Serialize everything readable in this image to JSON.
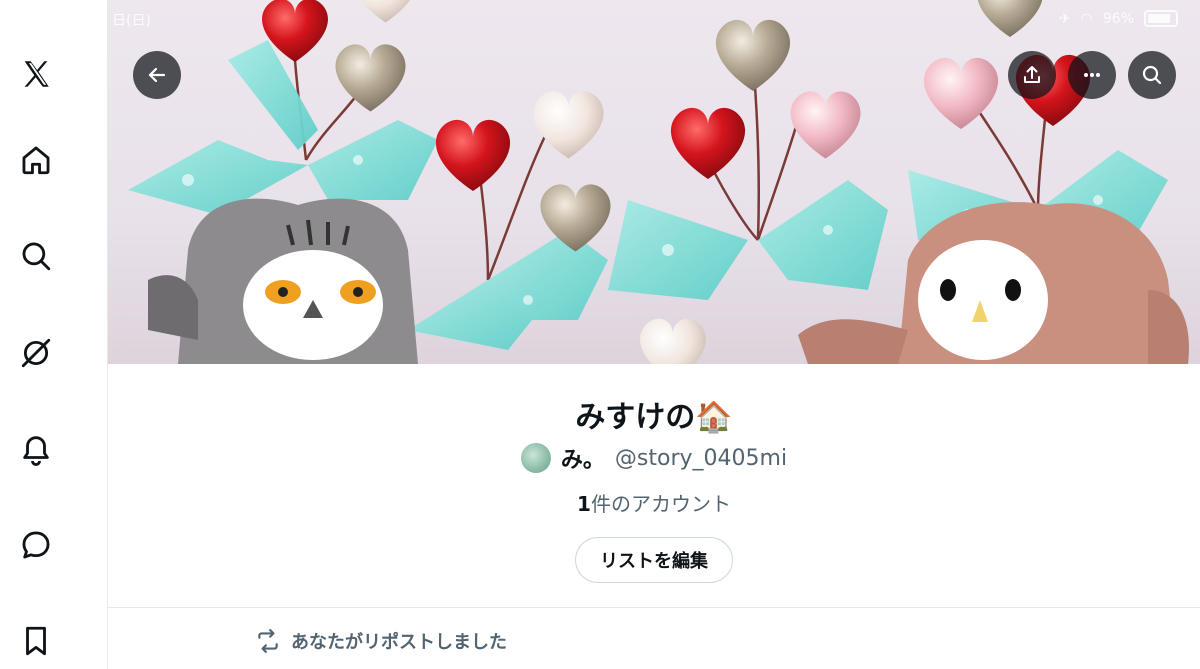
{
  "status_bar": {
    "left_text": "日(日) ",
    "battery": "96%"
  },
  "sidebar": {
    "items": [
      {
        "name": "x-logo-icon"
      },
      {
        "name": "home-icon"
      },
      {
        "name": "search-icon"
      },
      {
        "name": "grok-icon"
      },
      {
        "name": "notifications-icon"
      },
      {
        "name": "messages-icon"
      },
      {
        "name": "bookmarks-icon"
      }
    ]
  },
  "banner_buttons": {
    "back": "back-arrow-icon",
    "share": "share-icon",
    "more": "more-icon",
    "search": "search-icon"
  },
  "list": {
    "title": "みすけの🏠",
    "owner_name": "み。",
    "owner_handle": "@story_0405mi",
    "member_count": "1",
    "member_label": "件のアカウント",
    "edit_button": "リストを編集"
  },
  "timeline": {
    "repost_label": "あなたがリポストしました"
  },
  "colors": {
    "text_primary": "#0f1419",
    "text_secondary": "#536471",
    "border": "#cfd9de",
    "button_overlay": "#0f1419"
  }
}
